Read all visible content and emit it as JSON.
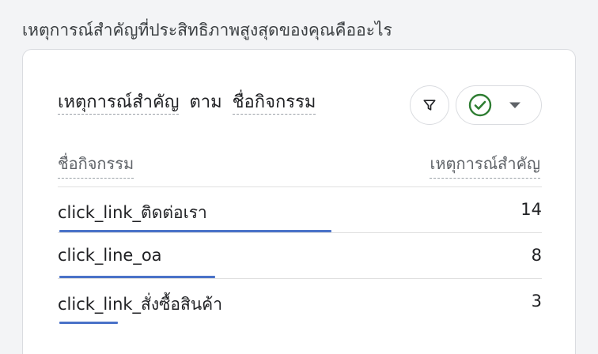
{
  "page_heading": "เหตุการณ์สำคัญที่ประสิทธิภาพสูงสุดของคุณคืออะไร",
  "card": {
    "title_metric": "เหตุการณ์สำคัญ",
    "title_by": "ตาม",
    "title_dimension": "ชื่อกิจกรรม",
    "filter_icon": "filter-icon",
    "compare_icon": "check-circle-icon",
    "caret_icon": "caret-down-icon",
    "accent_color": "#4a72c8",
    "check_color": "#2e7d32"
  },
  "table": {
    "col_left": "ชื่อกิจกรรม",
    "col_right": "เหตุการณ์สำคัญ",
    "max_value": 14,
    "rows": [
      {
        "name": "click_link_ติดต่อเรา",
        "value": 14
      },
      {
        "name": "click_line_oa",
        "value": 8
      },
      {
        "name": "click_link_สั่งซื้อสินค้า",
        "value": 3
      }
    ]
  }
}
